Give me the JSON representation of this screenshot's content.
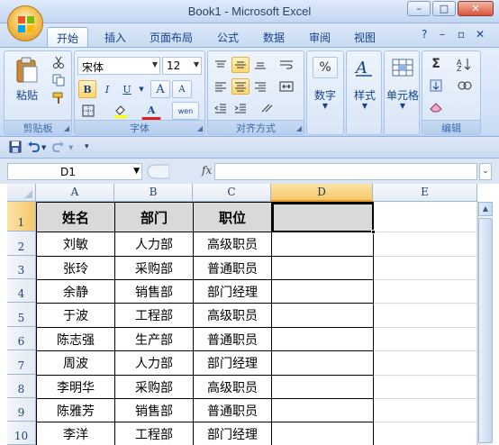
{
  "window": {
    "title": "Book1 - Microsoft Excel",
    "min": "–",
    "max": "□",
    "close": "✕"
  },
  "ribbon_tabs": [
    "开始",
    "插入",
    "页面布局",
    "公式",
    "数据",
    "审阅",
    "视图"
  ],
  "ribbon_right": {
    "help": "?",
    "min": "–",
    "restore": "▫",
    "close": "✕"
  },
  "groups": {
    "clipboard": {
      "label": "剪贴板",
      "paste": "粘贴"
    },
    "font": {
      "label": "字体",
      "name": "宋体",
      "size": "12",
      "bold": "B",
      "italic": "I",
      "underline": "U",
      "grow": "A",
      "shrink": "A",
      "font_color": "A",
      "phonetic": "wen"
    },
    "alignment": {
      "label": "对齐方式"
    },
    "number": {
      "label": "数字",
      "percent": "%"
    },
    "styles": {
      "label": "样式"
    },
    "cells": {
      "label": "单元格"
    },
    "editing": {
      "label": "编辑",
      "sum": "Σ"
    }
  },
  "formula_bar": {
    "name_box": "D1",
    "fx": "fx",
    "formula": ""
  },
  "columns": [
    "A",
    "B",
    "C",
    "D",
    "E"
  ],
  "rows": [
    "1",
    "2",
    "3",
    "4",
    "5",
    "6",
    "7",
    "8",
    "9",
    "10"
  ],
  "table": {
    "header": [
      "姓名",
      "部门",
      "职位"
    ],
    "data": [
      [
        "刘敏",
        "人力部",
        "高级职员"
      ],
      [
        "张玲",
        "采购部",
        "普通职员"
      ],
      [
        "余静",
        "销售部",
        "部门经理"
      ],
      [
        "于波",
        "工程部",
        "高级职员"
      ],
      [
        "陈志强",
        "生产部",
        "普通职员"
      ],
      [
        "周波",
        "人力部",
        "部门经理"
      ],
      [
        "李明华",
        "采购部",
        "高级职员"
      ],
      [
        "陈雅芳",
        "销售部",
        "普通职员"
      ],
      [
        "李洋",
        "工程部",
        "部门经理"
      ]
    ]
  },
  "selected_cell": "D1"
}
